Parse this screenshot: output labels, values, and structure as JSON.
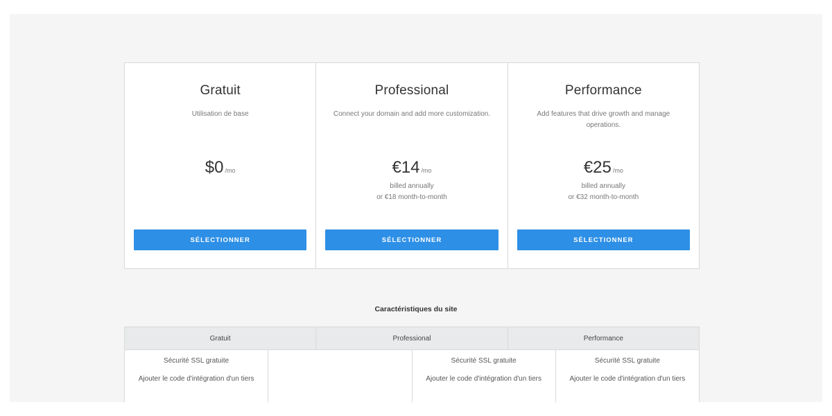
{
  "plans": [
    {
      "name": "Gratuit",
      "description": "Utilisation de base",
      "price": "$0",
      "per": "/mo",
      "billing_line1": "",
      "billing_line2": "",
      "button": "SÉLECTIONNER"
    },
    {
      "name": "Professional",
      "description": "Connect your domain and add more customization.",
      "price": "€14",
      "per": "/mo",
      "billing_line1": "billed annually",
      "billing_line2": "or €18 month-to-month",
      "button": "SÉLECTIONNER"
    },
    {
      "name": "Performance",
      "description": "Add features that drive growth and manage operations.",
      "price": "€25",
      "per": "/mo",
      "billing_line1": "billed annually",
      "billing_line2": "or €32 month-to-month",
      "button": "SÉLECTIONNER"
    }
  ],
  "features": {
    "title": "Caractéristiques du site",
    "headers": [
      "Gratuit",
      "Professional",
      "Performance"
    ],
    "columns": [
      [
        "Sécurité SSL gratuite",
        "Ajouter le code d'intégration d'un tiers"
      ],
      [],
      [
        "Sécurité SSL gratuite",
        "Ajouter le code d'intégration d'un tiers"
      ],
      [
        "Sécurité SSL gratuite",
        "Ajouter le code d'intégration d'un tiers"
      ]
    ]
  },
  "colors": {
    "button": "#2d8fe6",
    "background": "#f5f5f5",
    "header_bg": "#e9eaeb"
  }
}
